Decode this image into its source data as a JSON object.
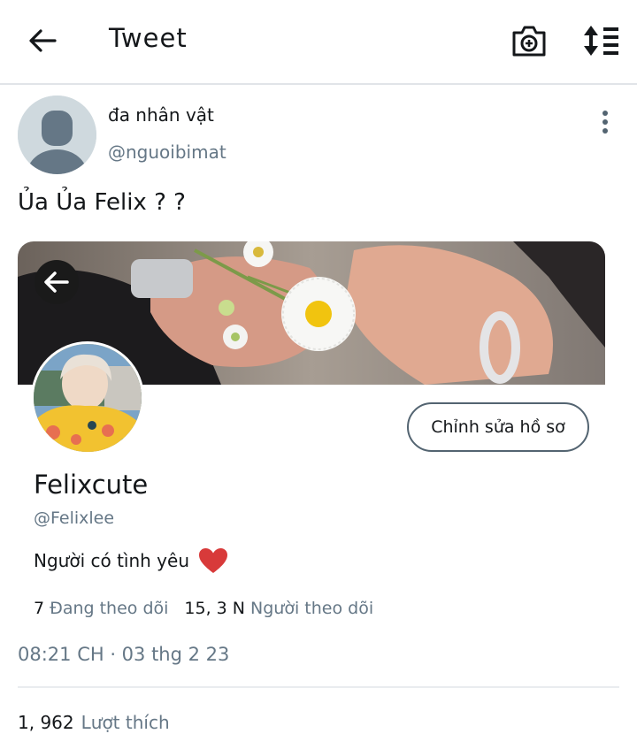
{
  "header": {
    "title": "Tweet"
  },
  "tweet": {
    "author_name": "đa nhân vật",
    "author_handle": "@nguoibimat",
    "text": "Ủa Ủa Felix ? ?",
    "timestamp": "08:21 CH · 03 thg 2 23",
    "likes_count": "1, 962",
    "likes_label": "Lượt thích"
  },
  "profile_card": {
    "name": "Felixcute",
    "handle": "@Felixlee",
    "bio": "Người có tình yêu",
    "edit_button_label": "Chỉnh sửa hồ sơ",
    "following_count": "7",
    "following_label": "Đang theo dõi",
    "followers_count": "15, 3 N",
    "followers_label": "Người theo dõi"
  },
  "icons": {
    "back": "arrow-left-icon",
    "camera": "camera-plus-icon",
    "sort": "sort-list-icon",
    "more": "more-vertical-icon",
    "heart": "heart-icon"
  },
  "colors": {
    "text": "#14171a",
    "muted": "#657786",
    "border": "#536471",
    "heart": "#d83a3a"
  }
}
